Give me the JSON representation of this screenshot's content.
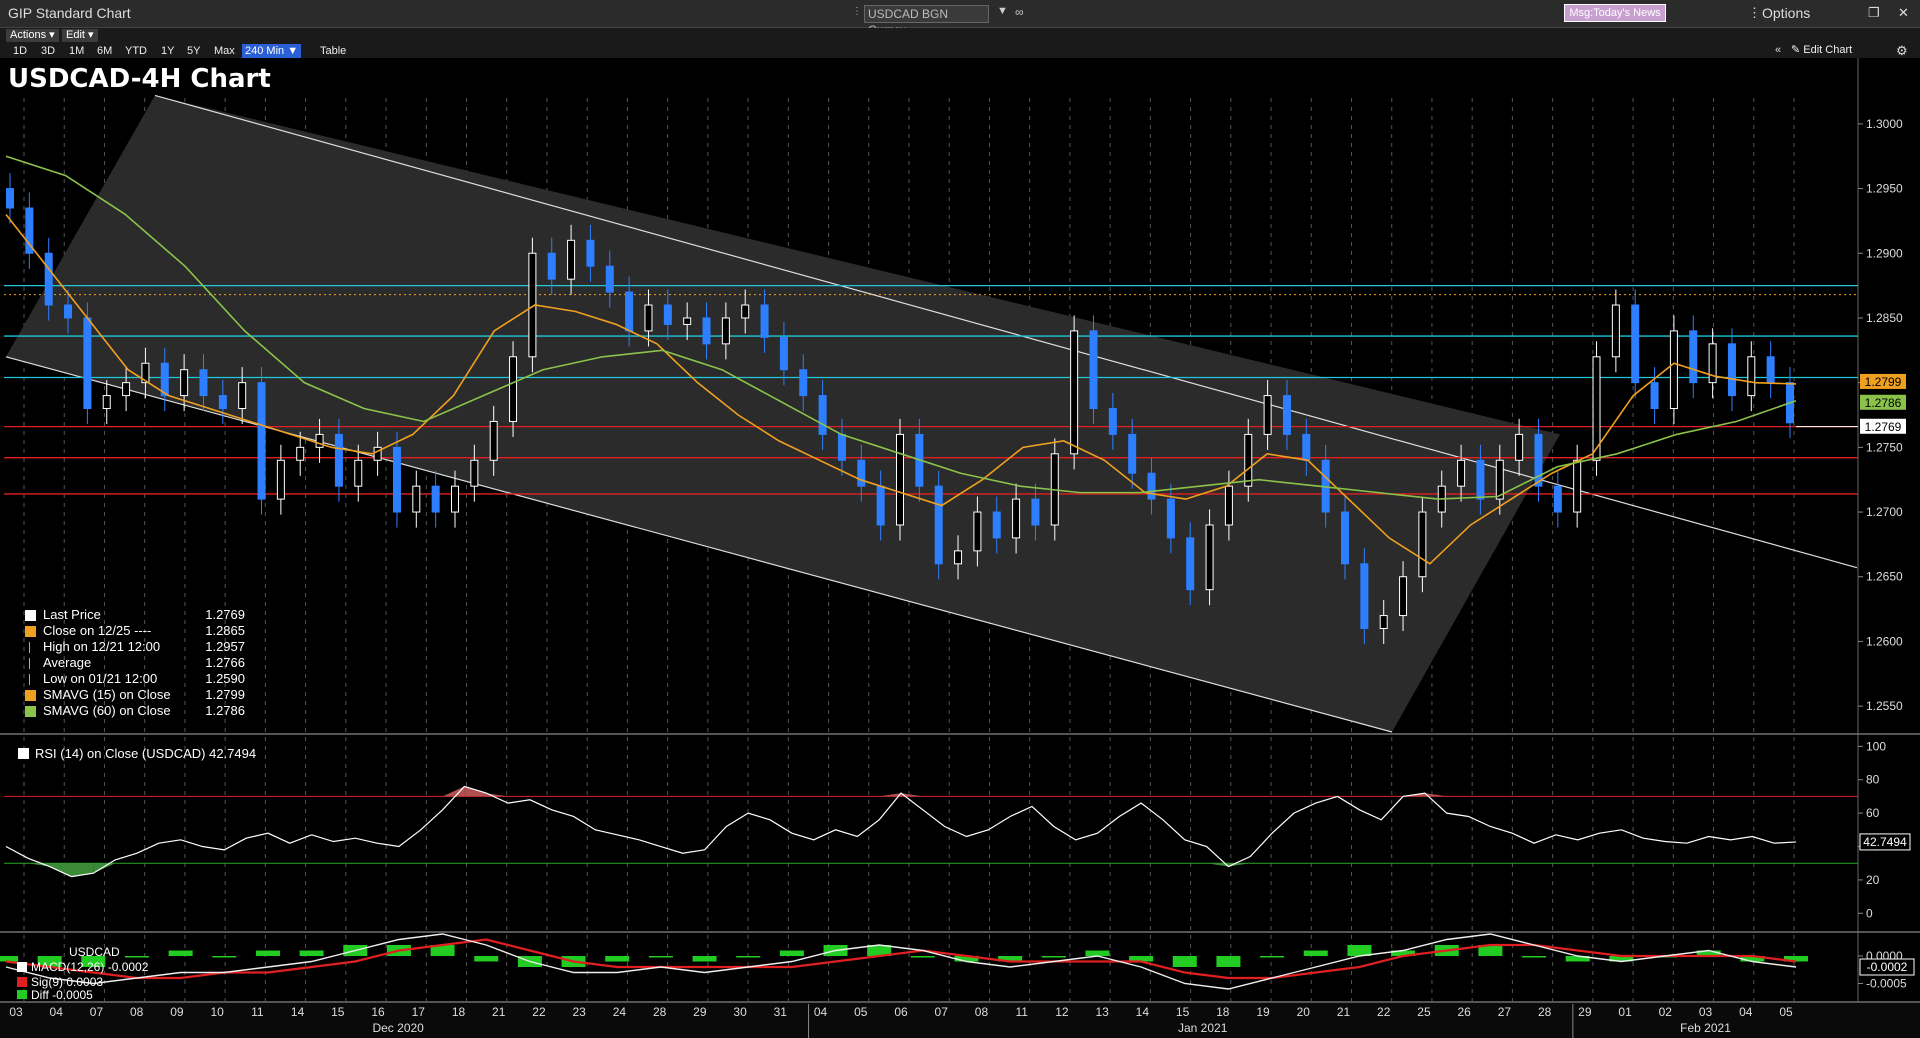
{
  "window": {
    "app_title": "GIP Standard Chart",
    "security": "USDCAD BGN Curncy",
    "msg_button": "Msg:Today's News",
    "options_label": "Options",
    "actions_menu": "Actions ▾",
    "edit_menu": "Edit ▾",
    "periods": [
      "1D",
      "3D",
      "1M",
      "6M",
      "YTD",
      "1Y",
      "5Y",
      "Max"
    ],
    "active_period": "240 Min ▼",
    "table_label": "Table",
    "edit_chart_label": "Edit Chart"
  },
  "colors": {
    "background": "#000000",
    "channel": "#2a2a2a",
    "up_candle": "#ffffff",
    "down_candle": "#2e7fff",
    "sma15": "#f0a020",
    "sma60": "#8bc34a",
    "cyan_level": "#1ec8d8",
    "red_level": "#e02020",
    "rsi": "#ffffff"
  },
  "chart_data": [
    {
      "type": "line",
      "title": "USDCAD-4H Chart",
      "ylim": [
        1.253,
        1.302
      ],
      "yticks": [
        "1.3000",
        "1.2950",
        "1.2900",
        "1.2850",
        "1.2800",
        "1.2750",
        "1.2700",
        "1.2650",
        "1.2600",
        "1.2550"
      ],
      "x_day_labels": [
        "03",
        "04",
        "07",
        "08",
        "09",
        "10",
        "11",
        "14",
        "15",
        "16",
        "17",
        "18",
        "21",
        "22",
        "23",
        "24",
        "28",
        "29",
        "30",
        "31",
        "04",
        "05",
        "06",
        "07",
        "08",
        "11",
        "12",
        "13",
        "14",
        "15",
        "18",
        "19",
        "20",
        "21",
        "22",
        "25",
        "26",
        "27",
        "28",
        "29",
        "01",
        "02",
        "03",
        "04",
        "05"
      ],
      "month_labels": [
        "Dec 2020",
        "Jan 2021",
        "Feb 2021"
      ],
      "horizontal_levels": {
        "cyan": [
          1.2875,
          1.2836,
          1.2804
        ],
        "red": [
          1.2766,
          1.2742,
          1.2714
        ],
        "orange_dotted": 1.2868
      },
      "channel": {
        "upper": [
          {
            "x": "Dec 08",
            "y": 1.3022
          },
          {
            "x": "Jan 28",
            "y": 1.276
          }
        ],
        "lower": [
          {
            "x": "Dec 03",
            "y": 1.282
          },
          {
            "x": "Jan 21",
            "y": 1.253
          }
        ],
        "right_line_end": {
          "x": "Feb 05+",
          "y": 1.2657
        }
      },
      "price_series": [
        1.2935,
        1.29,
        1.286,
        1.285,
        1.278,
        1.279,
        1.28,
        1.2815,
        1.279,
        1.281,
        1.279,
        1.278,
        1.28,
        1.271,
        1.274,
        1.275,
        1.276,
        1.272,
        1.274,
        1.275,
        1.27,
        1.272,
        1.27,
        1.272,
        1.274,
        1.277,
        1.282,
        1.29,
        1.288,
        1.291,
        1.289,
        1.287,
        1.284,
        1.286,
        1.2845,
        1.285,
        1.283,
        1.285,
        1.286,
        1.2835,
        1.281,
        1.279,
        1.276,
        1.274,
        1.272,
        1.269,
        1.276,
        1.272,
        1.266,
        1.267,
        1.27,
        1.268,
        1.271,
        1.269,
        1.2745,
        1.284,
        1.278,
        1.276,
        1.273,
        1.271,
        1.268,
        1.264,
        1.269,
        1.272,
        1.276,
        1.279,
        1.276,
        1.274,
        1.27,
        1.266,
        1.261,
        1.262,
        1.265,
        1.27,
        1.272,
        1.274,
        1.271,
        1.274,
        1.276,
        1.272,
        1.27,
        1.274,
        1.282,
        1.286,
        1.28,
        1.278,
        1.284,
        1.28,
        1.283,
        1.279,
        1.282,
        1.28,
        1.2769
      ],
      "sma15_series": [
        1.293,
        1.289,
        1.285,
        1.281,
        1.279,
        1.278,
        1.277,
        1.276,
        1.275,
        1.2745,
        1.276,
        1.279,
        1.284,
        1.286,
        1.2855,
        1.2845,
        1.283,
        1.28,
        1.2775,
        1.2755,
        1.274,
        1.2725,
        1.2715,
        1.2705,
        1.2725,
        1.275,
        1.2755,
        1.274,
        1.2715,
        1.271,
        1.272,
        1.2745,
        1.274,
        1.271,
        1.268,
        1.266,
        1.269,
        1.271,
        1.273,
        1.2745,
        1.279,
        1.2815,
        1.2805,
        1.28,
        1.2799
      ],
      "sma60_series": [
        1.2975,
        1.296,
        1.293,
        1.289,
        1.284,
        1.28,
        1.278,
        1.277,
        1.279,
        1.281,
        1.282,
        1.2825,
        1.281,
        1.2785,
        1.276,
        1.2745,
        1.273,
        1.272,
        1.2715,
        1.2715,
        1.272,
        1.2725,
        1.272,
        1.2715,
        1.271,
        1.2712,
        1.2735,
        1.2745,
        1.276,
        1.277,
        1.2786
      ],
      "right_axis_labels": [
        {
          "value": "1.2799",
          "color": "#f0a020"
        },
        {
          "value": "1.2786",
          "color": "#8bc34a"
        },
        {
          "value": "1.2769",
          "color": "#ffffff"
        }
      ]
    },
    {
      "type": "line",
      "title": "RSI (14)  on Close (USDCAD) 42.7494",
      "ylim": [
        -10,
        105
      ],
      "yticks": [
        "100",
        "80",
        "60",
        "40",
        "20",
        "0"
      ],
      "levels": {
        "overbought": 70,
        "oversold": 30
      },
      "last_value_label": "42.7494",
      "series": [
        {
          "name": "RSI (14)",
          "values": [
            40,
            33,
            28,
            22,
            24,
            32,
            36,
            42,
            44,
            40,
            38,
            45,
            48,
            42,
            47,
            43,
            45,
            42,
            40,
            50,
            62,
            76,
            72,
            66,
            68,
            62,
            58,
            50,
            47,
            44,
            40,
            36,
            38,
            52,
            60,
            56,
            48,
            44,
            50,
            46,
            56,
            72,
            62,
            52,
            46,
            50,
            58,
            64,
            52,
            44,
            48,
            58,
            66,
            56,
            44,
            40,
            28,
            34,
            48,
            60,
            66,
            70,
            62,
            56,
            70,
            72,
            60,
            58,
            52,
            48,
            42,
            47,
            44,
            48,
            50,
            45,
            43,
            42,
            46,
            44,
            46,
            42,
            42.75
          ]
        }
      ]
    },
    {
      "type": "bar",
      "title": "USDCAD",
      "ylim": [
        -0.0008,
        0.0004
      ],
      "yticks": [
        "0.0000",
        "-0.0005"
      ],
      "last_value_label": "-0.0002",
      "series": [
        {
          "name": "MACD(12,26)",
          "current": "-0.0002",
          "values": [
            -0.0002,
            -0.0004,
            -0.0005,
            -0.0004,
            -0.0003,
            -0.0003,
            -0.0002,
            -0.0001,
            0.0001,
            0.0003,
            0.0004,
            0.0002,
            -0.0001,
            -0.0003,
            -0.0003,
            -0.0002,
            -0.0003,
            -0.0002,
            -0.0001,
            0.0001,
            0.0002,
            0.0001,
            -0.0001,
            -0.0002,
            -0.0001,
            0.0,
            -0.0002,
            -0.0005,
            -0.0006,
            -0.0004,
            -0.0002,
            0.0,
            0.0001,
            0.0003,
            0.0004,
            0.0002,
            0.0,
            -0.0001,
            0.0,
            0.0001,
            -0.0001,
            -0.0002
          ]
        },
        {
          "name": "Sig(9)",
          "current": "0.0003",
          "values": [
            -0.0001,
            -0.0002,
            -0.0003,
            -0.0004,
            -0.0004,
            -0.0003,
            -0.0003,
            -0.0002,
            -0.0001,
            0.0001,
            0.0002,
            0.0003,
            0.0001,
            -0.0001,
            -0.0002,
            -0.0002,
            -0.0002,
            -0.0002,
            -0.0002,
            -0.0001,
            0.0,
            0.0001,
            0.0,
            -0.0001,
            -0.0001,
            -0.0001,
            -0.0001,
            -0.0003,
            -0.0004,
            -0.0004,
            -0.0003,
            -0.0002,
            0.0,
            0.0001,
            0.0002,
            0.0002,
            0.0001,
            0.0,
            0.0,
            0.0,
            0.0,
            -0.0001
          ]
        },
        {
          "name": "Diff",
          "current": "-0.0005"
        }
      ]
    }
  ],
  "legend": {
    "items": [
      {
        "label": "Last Price",
        "value": "1.2769",
        "swatch": "#ffffff"
      },
      {
        "label": "Close on 12/25 ----",
        "value": "1.2865",
        "swatch": "#f0a020"
      },
      {
        "label": "High on 12/21 12:00",
        "value": "1.2957",
        "swatch": "hi"
      },
      {
        "label": "Average",
        "value": "1.2766",
        "swatch": "avg"
      },
      {
        "label": "Low on 01/21 12:00",
        "value": "1.2590",
        "swatch": "lo"
      },
      {
        "label": "SMAVG (15)  on Close",
        "value": "1.2799",
        "swatch": "#f0a020"
      },
      {
        "label": "SMAVG (60)  on Close",
        "value": "1.2786",
        "swatch": "#8bc34a"
      }
    ]
  }
}
